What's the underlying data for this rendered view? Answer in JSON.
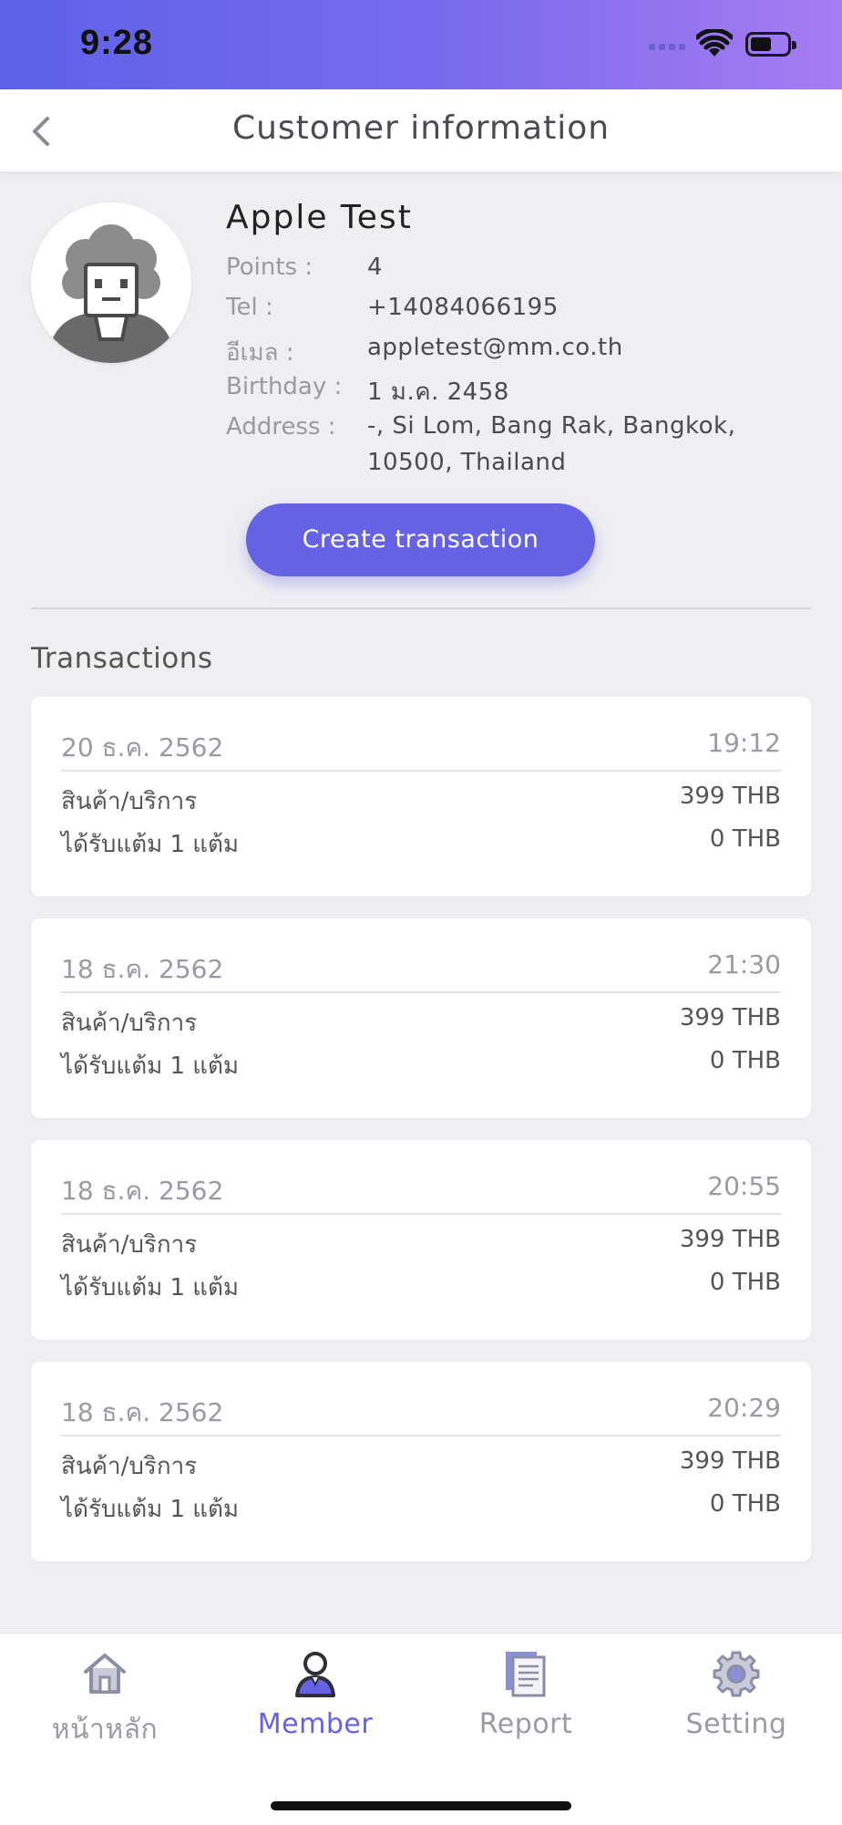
{
  "status_bar": {
    "time": "9:28",
    "icons": [
      "signal-icon",
      "wifi-icon",
      "battery-icon"
    ]
  },
  "nav": {
    "title": "Customer information",
    "back_icon": "chevron-left-icon"
  },
  "customer": {
    "name": "Apple Test",
    "fields": [
      {
        "label": "Points :",
        "value": "4"
      },
      {
        "label": "Tel :",
        "value": "+14084066195"
      },
      {
        "label": "อีเมล :",
        "value": "appletest@mm.co.th"
      },
      {
        "label": "Birthday :",
        "value": "1 ม.ค. 2458"
      },
      {
        "label": "Address :",
        "value": "-, Si Lom, Bang Rak, Bangkok, 10500, Thailand"
      }
    ]
  },
  "actions": {
    "create_transaction": "Create transaction"
  },
  "transactions": {
    "title": "Transactions",
    "items": [
      {
        "date": "20 ธ.ค. 2562",
        "time": "19:12",
        "item_label": "สินค้า/บริการ",
        "item_amount": "399 THB",
        "points_label": "ได้รับแต้ม 1 แต้ม",
        "points_amount": "0 THB"
      },
      {
        "date": "18 ธ.ค. 2562",
        "time": "21:30",
        "item_label": "สินค้า/บริการ",
        "item_amount": "399 THB",
        "points_label": "ได้รับแต้ม 1 แต้ม",
        "points_amount": "0 THB"
      },
      {
        "date": "18 ธ.ค. 2562",
        "time": "20:55",
        "item_label": "สินค้า/บริการ",
        "item_amount": "399 THB",
        "points_label": "ได้รับแต้ม 1 แต้ม",
        "points_amount": "0 THB"
      },
      {
        "date": "18 ธ.ค. 2562",
        "time": "20:29",
        "item_label": "สินค้า/บริการ",
        "item_amount": "399 THB",
        "points_label": "ได้รับแต้ม 1 แต้ม",
        "points_amount": "0 THB"
      }
    ]
  },
  "tab_bar": {
    "active": "Member",
    "accent_color": "#6562e3",
    "tabs": [
      {
        "label": "หน้าหลัก",
        "icon": "home-icon"
      },
      {
        "label": "Member",
        "icon": "person-icon"
      },
      {
        "label": "Report",
        "icon": "document-icon"
      },
      {
        "label": "Setting",
        "icon": "gear-icon"
      }
    ]
  }
}
